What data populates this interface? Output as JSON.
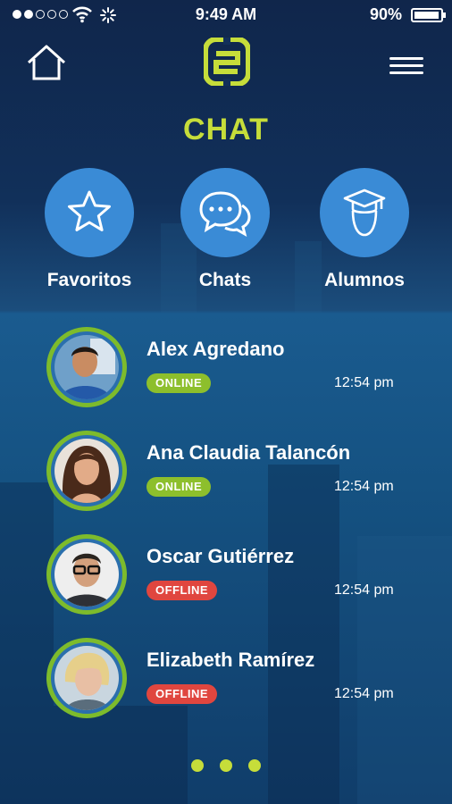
{
  "colors": {
    "accent": "#c6dd3a",
    "button": "#3a8bd6",
    "online": "#8dbf2c",
    "offline": "#e0463f"
  },
  "status_bar": {
    "time": "9:49 AM",
    "battery": "90%"
  },
  "header": {
    "home_icon": "home-icon",
    "logo_icon": "app-logo-icon",
    "menu_icon": "hamburger-menu-icon"
  },
  "title": "CHAT",
  "categories": [
    {
      "label": "Favoritos",
      "icon": "star-icon"
    },
    {
      "label": "Chats",
      "icon": "chat-bubbles-icon"
    },
    {
      "label": "Alumnos",
      "icon": "graduate-icon"
    }
  ],
  "contacts": [
    {
      "name": "Alex Agredano",
      "status": "ONLINE",
      "time": "12:54 pm"
    },
    {
      "name": "Ana Claudia Talancón",
      "status": "ONLINE",
      "time": "12:54 pm"
    },
    {
      "name": "Oscar Gutiérrez",
      "status": "OFFLINE",
      "time": "12:54 pm"
    },
    {
      "name": "Elizabeth Ramírez",
      "status": "OFFLINE",
      "time": "12:54 pm"
    }
  ],
  "pager": {
    "pages": 3
  }
}
